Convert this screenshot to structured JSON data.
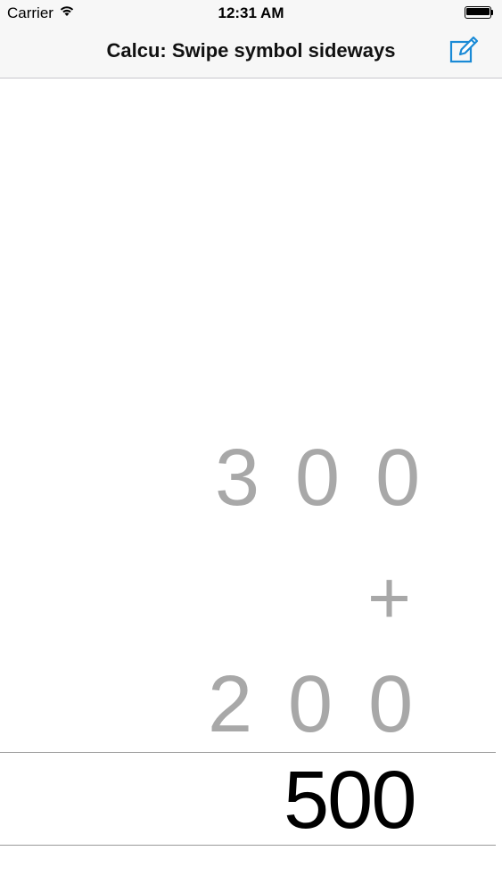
{
  "status_bar": {
    "carrier": "Carrier",
    "time": "12:31 AM",
    "wifi_icon": "wifi-icon",
    "battery_icon": "battery-icon",
    "battery_level": 1.0
  },
  "nav_bar": {
    "title": "Calcu: Swipe symbol sideways",
    "compose_icon": "compose-icon",
    "accent_color": "#1a8ad6"
  },
  "calculator": {
    "operand_1": "300",
    "operator": "+",
    "operand_2": "200",
    "result": "500",
    "operand_color": "#a8a8a8",
    "result_color": "#000000"
  }
}
